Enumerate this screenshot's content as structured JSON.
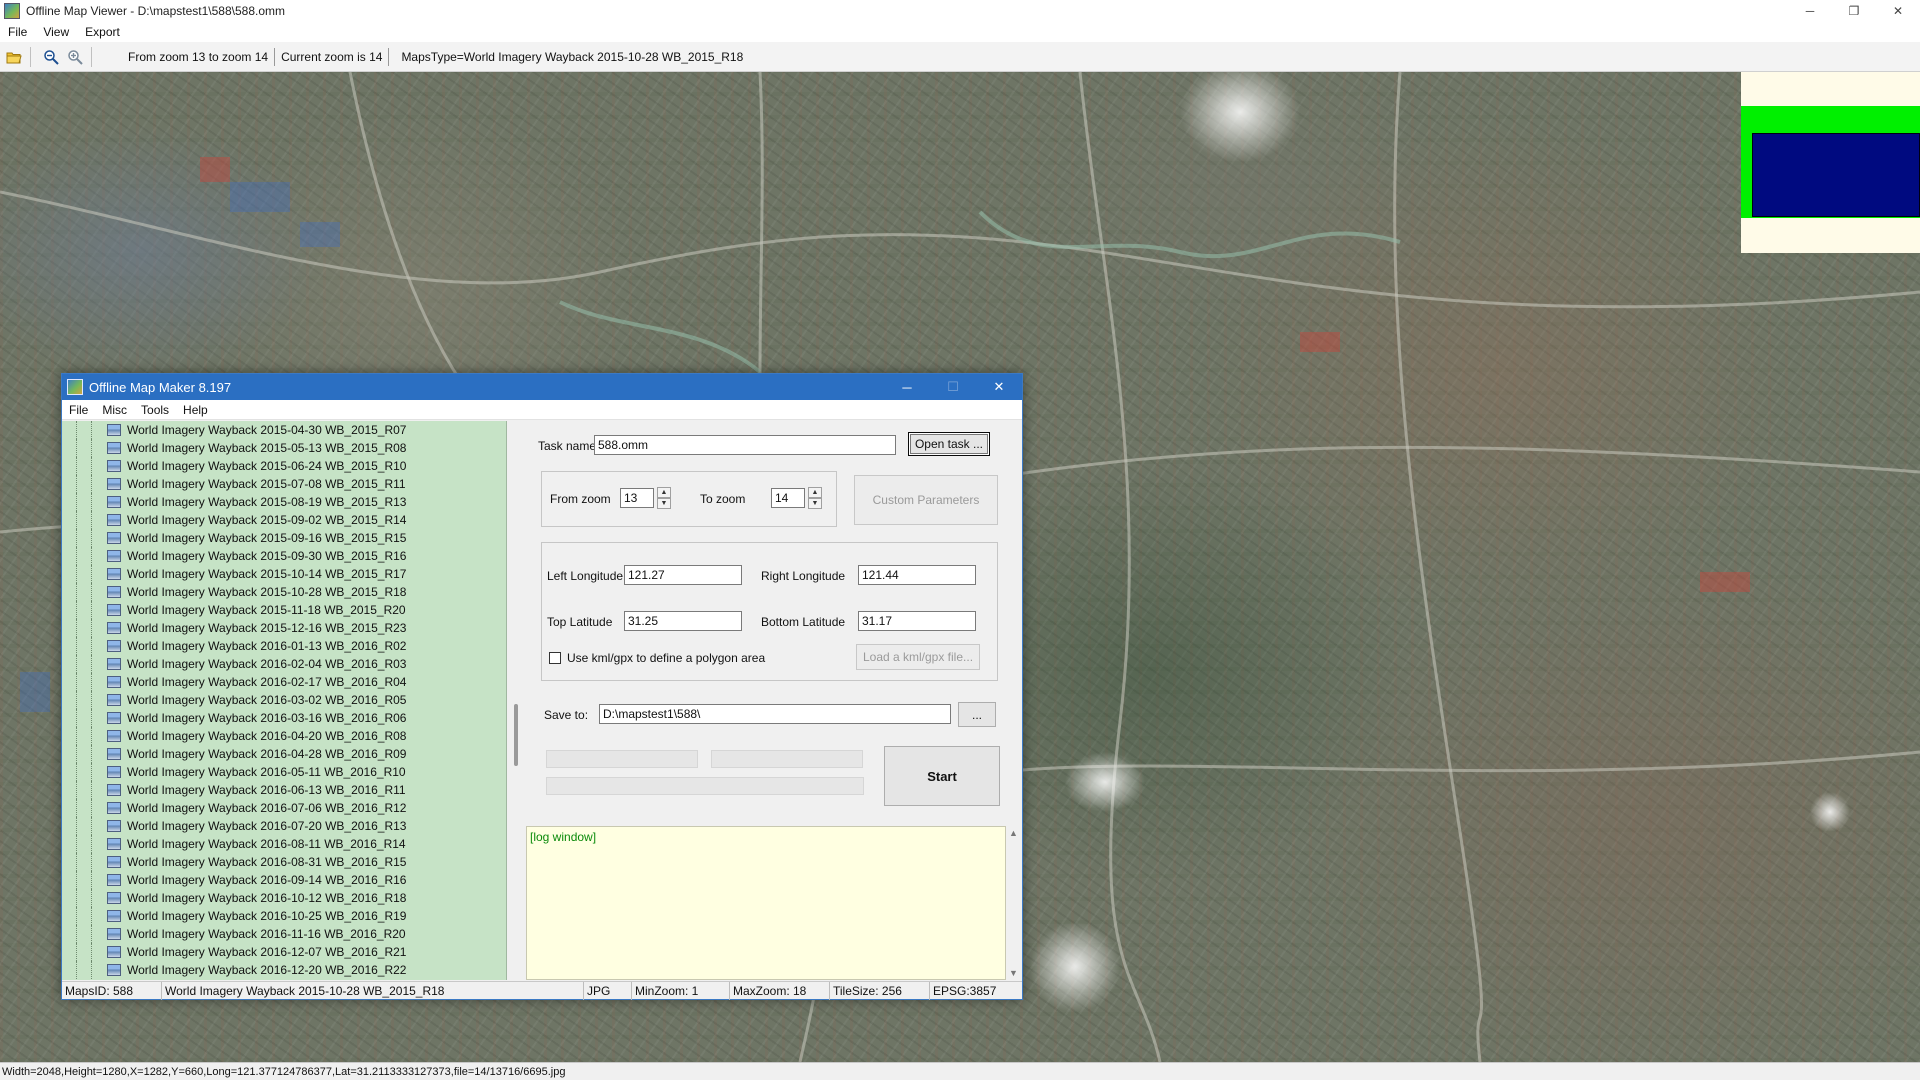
{
  "viewer": {
    "title": "Offline Map Viewer - D:\\mapstest1\\588\\588.omm",
    "window_controls": {
      "minimize": "─",
      "restore": "❐",
      "close": "✕"
    },
    "menu": [
      "File",
      "View",
      "Export"
    ],
    "toolbar": {
      "zoom_range": "From zoom 13 to zoom 14",
      "current_zoom": "Current zoom is 14",
      "maps_type": "MapsType=World Imagery Wayback 2015-10-28 WB_2015_R18"
    },
    "status": "Width=2048,Height=1280,X=1282,Y=660,Long=121.377124786377,Lat=31.2113333127373,file=14/13716/6695.jpg"
  },
  "dialog": {
    "title": "Offline Map Maker 8.197",
    "window_controls": {
      "minimize": "─",
      "maximize": "☐",
      "close": "✕"
    },
    "menu": [
      "File",
      "Misc",
      "Tools",
      "Help"
    ],
    "tree_items": [
      "World Imagery Wayback 2015-04-30 WB_2015_R07",
      "World Imagery Wayback 2015-05-13 WB_2015_R08",
      "World Imagery Wayback 2015-06-24 WB_2015_R10",
      "World Imagery Wayback 2015-07-08 WB_2015_R11",
      "World Imagery Wayback 2015-08-19 WB_2015_R13",
      "World Imagery Wayback 2015-09-02 WB_2015_R14",
      "World Imagery Wayback 2015-09-16 WB_2015_R15",
      "World Imagery Wayback 2015-09-30 WB_2015_R16",
      "World Imagery Wayback 2015-10-14 WB_2015_R17",
      "World Imagery Wayback 2015-10-28 WB_2015_R18",
      "World Imagery Wayback 2015-11-18 WB_2015_R20",
      "World Imagery Wayback 2015-12-16 WB_2015_R23",
      "World Imagery Wayback 2016-01-13 WB_2016_R02",
      "World Imagery Wayback 2016-02-04 WB_2016_R03",
      "World Imagery Wayback 2016-02-17 WB_2016_R04",
      "World Imagery Wayback 2016-03-02 WB_2016_R05",
      "World Imagery Wayback 2016-03-16 WB_2016_R06",
      "World Imagery Wayback 2016-04-20 WB_2016_R08",
      "World Imagery Wayback 2016-04-28 WB_2016_R09",
      "World Imagery Wayback 2016-05-11 WB_2016_R10",
      "World Imagery Wayback 2016-06-13 WB_2016_R11",
      "World Imagery Wayback 2016-07-06 WB_2016_R12",
      "World Imagery Wayback 2016-07-20 WB_2016_R13",
      "World Imagery Wayback 2016-08-11 WB_2016_R14",
      "World Imagery Wayback 2016-08-31 WB_2016_R15",
      "World Imagery Wayback 2016-09-14 WB_2016_R16",
      "World Imagery Wayback 2016-10-12 WB_2016_R18",
      "World Imagery Wayback 2016-10-25 WB_2016_R19",
      "World Imagery Wayback 2016-11-16 WB_2016_R20",
      "World Imagery Wayback 2016-12-07 WB_2016_R21",
      "World Imagery Wayback 2016-12-20 WB_2016_R22"
    ],
    "form": {
      "task_name_label": "Task name",
      "task_name_value": "588.omm",
      "open_task_button": "Open task ...",
      "from_zoom_label": "From zoom",
      "from_zoom_value": "13",
      "to_zoom_label": "To zoom",
      "to_zoom_value": "14",
      "custom_params_button": "Custom Parameters",
      "left_lon_label": "Left Longitude",
      "left_lon_value": "121.27",
      "right_lon_label": "Right Longitude",
      "right_lon_value": "121.44",
      "top_lat_label": "Top Latitude",
      "top_lat_value": "31.25",
      "bottom_lat_label": "Bottom Latitude",
      "bottom_lat_value": "31.17",
      "kml_checkbox_label": "Use kml/gpx to define a polygon area",
      "load_kml_button": "Load a kml/gpx file...",
      "save_to_label": "Save to:",
      "save_to_value": "D:\\mapstest1\\588\\",
      "browse_button": "...",
      "start_button": "Start"
    },
    "log_text": "[log window]",
    "status": {
      "maps_id": "MapsID: 588",
      "maps_name": "World Imagery Wayback 2015-10-28 WB_2015_R18",
      "format": "JPG",
      "min_zoom": "MinZoom: 1",
      "max_zoom": "MaxZoom: 18",
      "tile_size": "TileSize: 256",
      "epsg": "EPSG:3857"
    }
  }
}
